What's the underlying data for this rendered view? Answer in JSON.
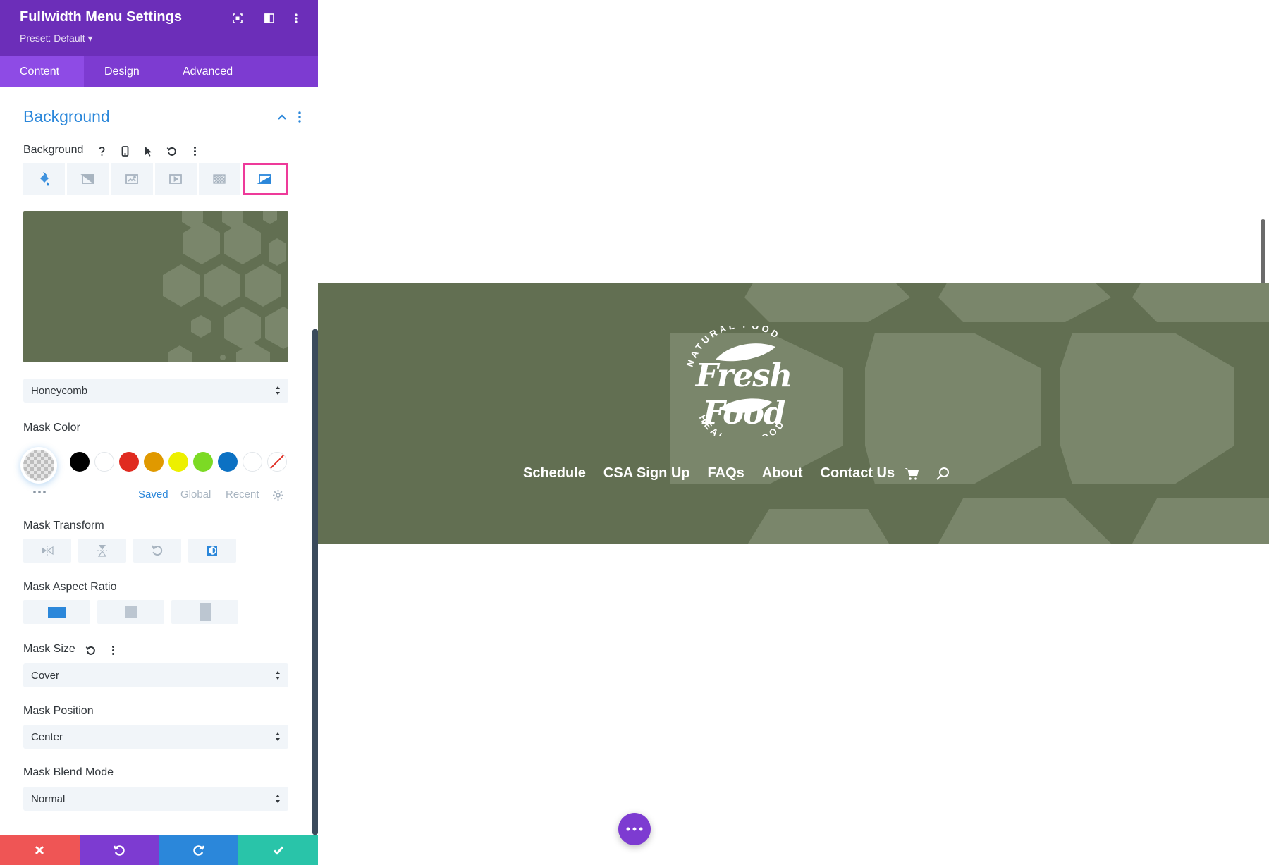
{
  "panel": {
    "title": "Fullwidth Menu Settings",
    "preset": "Preset: Default ▾",
    "tabs": [
      {
        "label": "Content",
        "active": true
      },
      {
        "label": "Design",
        "active": false
      },
      {
        "label": "Advanced",
        "active": false
      }
    ]
  },
  "section": {
    "title": "Background",
    "background_label": "Background",
    "bg_types": [
      "color-icon",
      "gradient-icon",
      "image-icon",
      "video-icon",
      "pattern-icon",
      "mask-icon"
    ],
    "active_bg_type": "mask-icon",
    "mask_style": "Honeycomb",
    "mask_color_label": "Mask Color",
    "swatches": [
      "#000000",
      "#ffffff",
      "#e02b20",
      "#e09900",
      "#edf000",
      "#7cda24",
      "#0c71c3",
      "#ffffff"
    ],
    "color_tabs": [
      {
        "label": "Saved",
        "active": true
      },
      {
        "label": "Global",
        "active": false
      },
      {
        "label": "Recent",
        "active": false
      }
    ],
    "mask_transform_label": "Mask Transform",
    "mask_aspect_label": "Mask Aspect Ratio",
    "mask_size_label": "Mask Size",
    "mask_size": "Cover",
    "mask_position_label": "Mask Position",
    "mask_position": "Center",
    "mask_blend_label": "Mask Blend Mode",
    "mask_blend": "Normal"
  },
  "footer": {
    "colors": {
      "discard": "#ef5555",
      "undo": "#7d3bd1",
      "redo": "#2b87da",
      "save": "#29c4a9"
    }
  },
  "site": {
    "logo_top": "NATURAL FOOD",
    "logo_main": "Fresh Food",
    "logo_bottom": "HEALTHY FOOD",
    "nav": [
      "Schedule",
      "CSA Sign Up",
      "FAQs",
      "About",
      "Contact Us"
    ],
    "bg_color": "#626f52"
  }
}
